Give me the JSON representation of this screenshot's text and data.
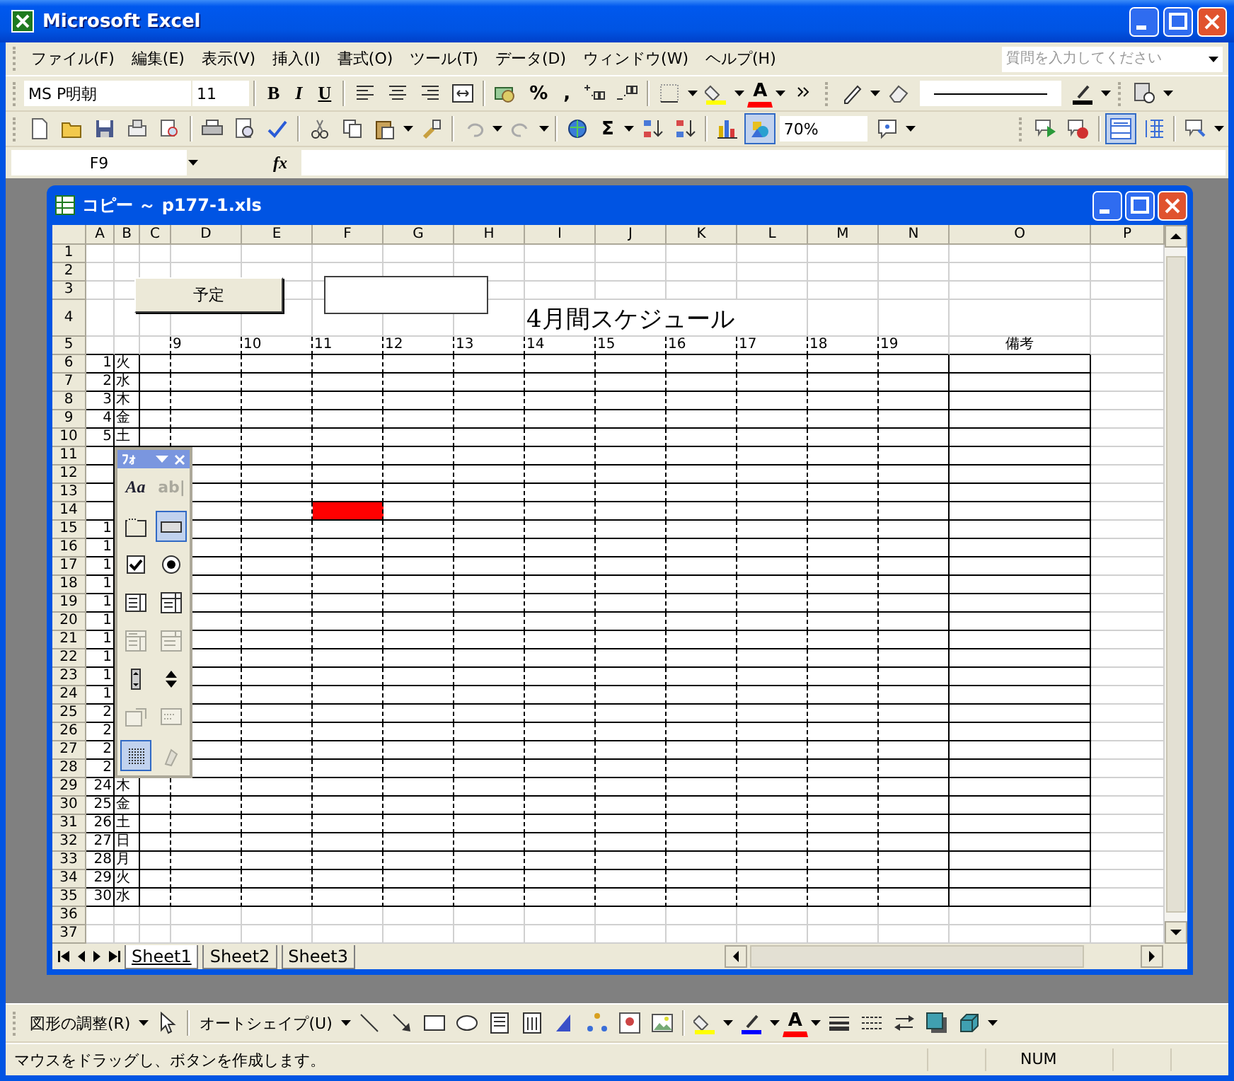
{
  "window": {
    "title": "Microsoft Excel"
  },
  "menu": [
    "ファイル(F)",
    "編集(E)",
    "表示(V)",
    "挿入(I)",
    "書式(O)",
    "ツール(T)",
    "データ(D)",
    "ウィンドウ(W)",
    "ヘルプ(H)"
  ],
  "help_search": {
    "placeholder": "質問を入力してください"
  },
  "formatting_toolbar": {
    "font": "MS P明朝",
    "size": "11",
    "bold": "B",
    "italic": "I",
    "underline": "U",
    "percent": "%",
    "comma": ",",
    "font_color": "A"
  },
  "standard_toolbar": {
    "autosum": "Σ",
    "zoom": "70%"
  },
  "formula_bar": {
    "name_box": "F9",
    "function_label": "fx"
  },
  "workbook": {
    "title": "コピー ～ p177-1.xls",
    "column_headers": [
      "A",
      "B",
      "C",
      "D",
      "E",
      "F",
      "G",
      "H",
      "I",
      "J",
      "K",
      "L",
      "M",
      "N",
      "O",
      "P"
    ],
    "row_headers": [
      "1",
      "2",
      "3",
      "4",
      "5",
      "6",
      "7",
      "8",
      "9",
      "10",
      "11",
      "12",
      "13",
      "14",
      "15",
      "16",
      "17",
      "18",
      "19",
      "20",
      "21",
      "22",
      "23",
      "24",
      "25",
      "26",
      "27",
      "28",
      "29",
      "30",
      "31",
      "32",
      "33",
      "34",
      "35",
      "36",
      "37"
    ],
    "button_label": "予定",
    "sheet_title": "4月間スケジュール",
    "hour_headers": [
      "9",
      "10",
      "11",
      "12",
      "13",
      "14",
      "15",
      "16",
      "17",
      "18",
      "19"
    ],
    "notes_header": "備考",
    "days": [
      {
        "day": "1",
        "weekday": "火",
        "highlighted": false
      },
      {
        "day": "2",
        "weekday": "水",
        "highlighted": false
      },
      {
        "day": "3",
        "weekday": "木",
        "highlighted": false
      },
      {
        "day": "4",
        "weekday": "金",
        "highlighted": false
      },
      {
        "day": "5",
        "weekday": "土",
        "highlighted": false
      },
      {
        "highlighted": false
      },
      {
        "highlighted": false
      },
      {
        "highlighted": false
      },
      {
        "highlighted": true
      },
      {
        "day": "1",
        "highlighted": false
      },
      {
        "day": "1",
        "highlighted": false
      },
      {
        "day": "1",
        "highlighted": false
      },
      {
        "day": "1",
        "highlighted": false
      },
      {
        "day": "1",
        "highlighted": false
      },
      {
        "day": "1",
        "highlighted": false
      },
      {
        "day": "1",
        "highlighted": false
      },
      {
        "day": "1",
        "highlighted": false
      },
      {
        "day": "1",
        "highlighted": false
      },
      {
        "day": "1",
        "highlighted": false
      },
      {
        "day": "2",
        "highlighted": false
      },
      {
        "day": "2",
        "highlighted": false
      },
      {
        "day": "2",
        "highlighted": false
      },
      {
        "day": "2",
        "highlighted": false
      },
      {
        "day": "24",
        "weekday": "木",
        "highlighted": false
      },
      {
        "day": "25",
        "weekday": "金",
        "highlighted": false
      },
      {
        "day": "26",
        "weekday": "土",
        "highlighted": false
      },
      {
        "day": "27",
        "weekday": "日",
        "highlighted": false
      },
      {
        "day": "28",
        "weekday": "月",
        "highlighted": false
      },
      {
        "day": "29",
        "weekday": "火",
        "highlighted": false
      },
      {
        "day": "30",
        "weekday": "水",
        "highlighted": false
      }
    ],
    "sheet_tabs": [
      {
        "label": "Sheet1",
        "selected": true
      },
      {
        "label": "Sheet2",
        "selected": false
      },
      {
        "label": "Sheet3",
        "selected": false
      }
    ]
  },
  "forms_toolbar": {
    "title": "ﾌｫ",
    "tools": [
      {
        "kind": "label",
        "label": "Aa",
        "disabled": false,
        "selected": false
      },
      {
        "kind": "edit_box",
        "label": "ab|",
        "disabled": true,
        "selected": false
      },
      {
        "kind": "group_box",
        "disabled": false,
        "selected": false
      },
      {
        "kind": "button",
        "disabled": false,
        "selected": true
      },
      {
        "kind": "checkbox",
        "disabled": false,
        "selected": false
      },
      {
        "kind": "option_button",
        "disabled": false,
        "selected": false
      },
      {
        "kind": "list_box",
        "disabled": false,
        "selected": false
      },
      {
        "kind": "combo_box",
        "disabled": false,
        "selected": false
      },
      {
        "kind": "combo_list_edit",
        "disabled": true,
        "selected": false
      },
      {
        "kind": "combo_dropdown_edit",
        "disabled": true,
        "selected": false
      },
      {
        "kind": "scroll_bar",
        "disabled": false,
        "selected": false
      },
      {
        "kind": "spinner",
        "disabled": false,
        "selected": false
      },
      {
        "kind": "control_properties",
        "disabled": true,
        "selected": false
      },
      {
        "kind": "edit_code",
        "disabled": true,
        "selected": false
      },
      {
        "kind": "toggle_grid",
        "disabled": false,
        "selected": true
      },
      {
        "kind": "run_dialog",
        "disabled": true,
        "selected": false
      }
    ]
  },
  "drawing_toolbar": {
    "draw_menu": "図形の調整(R)",
    "autoshapes_menu": "オートシェイプ(U)",
    "font_color": "A"
  },
  "status_bar": {
    "message": "マウスをドラッグし、ボタンを作成します。",
    "num_lock": "NUM"
  }
}
